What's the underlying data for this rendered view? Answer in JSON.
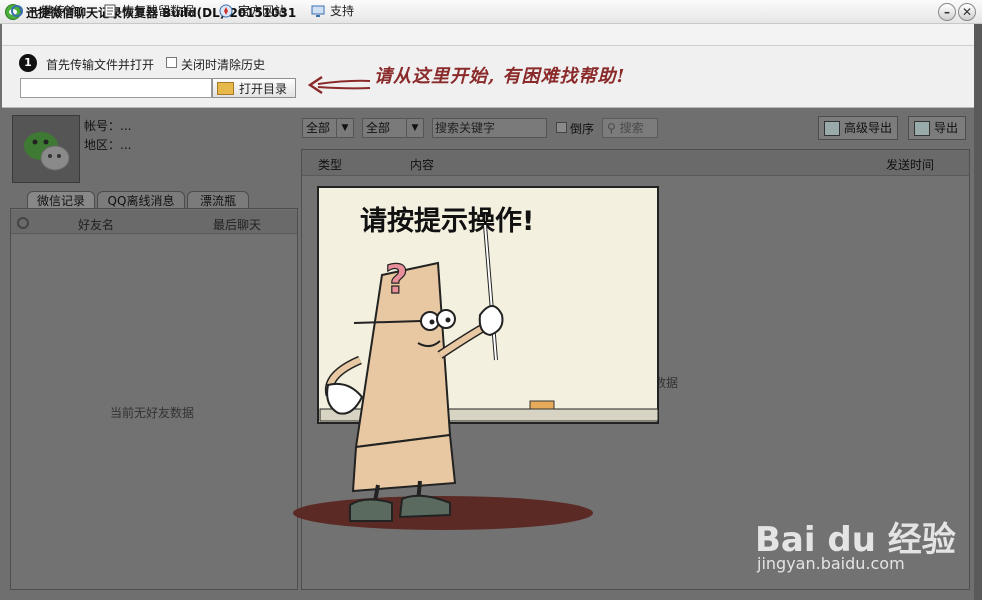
{
  "window": {
    "title": "迅捷微信聊天记录恢复器 Build(DL) 20151031"
  },
  "menu": {
    "items": [
      {
        "label": "一键传输",
        "icon": "transfer-icon"
      },
      {
        "label": "恢复残留数据",
        "icon": "document-icon"
      },
      {
        "label": "官方网站",
        "icon": "compass-icon"
      },
      {
        "label": "支持",
        "icon": "monitor-icon"
      }
    ]
  },
  "toolbar": {
    "step_number": "1",
    "step_label": "首先传输文件并打开",
    "close_clear_label": "关闭时清除历史",
    "close_clear_checked": false,
    "path_value": "",
    "open_dir_label": "打开目录",
    "hint_text": "请从这里开始, 有困难找帮助!"
  },
  "account": {
    "account_label": "帐号：...",
    "region_label": "地区：..."
  },
  "left": {
    "tabs": [
      "微信记录",
      "QQ离线消息",
      "漂流瓶"
    ],
    "active_tab": "微信记录",
    "columns": [
      "好友名",
      "最后聊天"
    ],
    "empty_text": "当前无好友数据"
  },
  "filters": {
    "type_filter": "全部",
    "scope_filter": "全部",
    "search_placeholder": "搜索关键字",
    "reverse_label": "倒序",
    "reverse_checked": false,
    "search_button": "搜索",
    "advanced_export": "高级导出",
    "export": "导出"
  },
  "right": {
    "columns": [
      "类型",
      "内容",
      "发送时间"
    ],
    "empty_text": "数据"
  },
  "illustration": {
    "board_text": "请按提示操作!",
    "question_mark": "?"
  },
  "watermark": {
    "logo": "Bai du 经验",
    "url": "jingyan.baidu.com"
  },
  "colors": {
    "accent_red": "#8a2a2a",
    "overlay_gray": "#727272"
  }
}
